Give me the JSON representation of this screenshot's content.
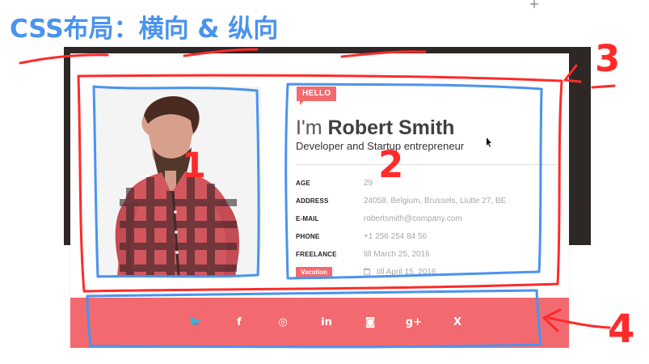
{
  "annotations": {
    "heading": "CSS布局：横向 & 纵向",
    "marker_1": "1",
    "marker_2": "2",
    "marker_3": "3",
    "marker_4": "4"
  },
  "profile": {
    "hello_badge": "HELLO",
    "prefix": "I'm",
    "name": "Robert Smith",
    "tagline": "Developer and Startup entrepreneur",
    "details": [
      {
        "label": "AGE",
        "value": "29"
      },
      {
        "label": "ADDRESS",
        "value": "24058, Belgium, Brussels, Liutte 27, BE"
      },
      {
        "label": "E-MAIL",
        "value": "robertsmith@company.com"
      },
      {
        "label": "PHONE",
        "value": "+1 256 254 84 56"
      },
      {
        "label": "FREELANCE",
        "value": "till March 25, 2016"
      }
    ],
    "vacation": {
      "label": "Vacation",
      "value": "till April 15, 2016"
    }
  },
  "social": {
    "icons": [
      {
        "name": "twitter-icon",
        "glyph": "🐦"
      },
      {
        "name": "facebook-icon",
        "glyph": "f"
      },
      {
        "name": "dribbble-icon",
        "glyph": "◎"
      },
      {
        "name": "linkedin-icon",
        "glyph": "in"
      },
      {
        "name": "instagram-icon",
        "glyph": "◙"
      },
      {
        "name": "google-plus-icon",
        "glyph": "g+"
      },
      {
        "name": "xing-icon",
        "glyph": "X"
      }
    ]
  },
  "colors": {
    "accent": "#f26a6f",
    "annotation_red": "#ff2a2a",
    "annotation_blue": "#4a93ef",
    "dark_header": "#2d2725"
  }
}
